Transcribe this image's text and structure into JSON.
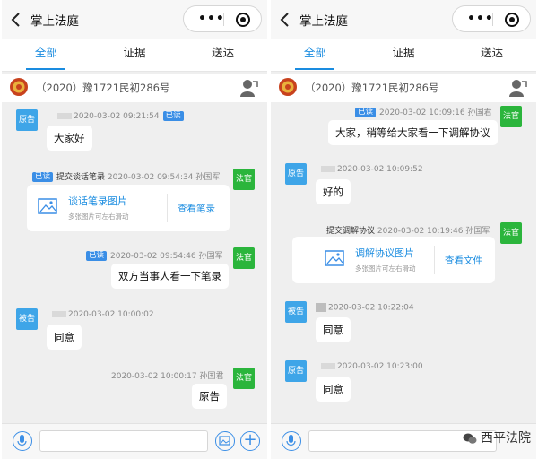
{
  "app": {
    "title": "掌上法庭"
  },
  "tabs": [
    {
      "label": "全部"
    },
    {
      "label": "证据"
    },
    {
      "label": "送达"
    }
  ],
  "case": {
    "number": "（2020）豫1721民初286号"
  },
  "colors": {
    "accent": "#1a8ce0",
    "plaintiff": "#3ea5e8",
    "judge": "#2bb53c",
    "read_badge": "#3a8ee6"
  },
  "left_panel": {
    "messages": [
      {
        "role": "原告",
        "time": "2020-03-02 09:21:54",
        "status": "已读",
        "text": "大家好"
      },
      {
        "role": "法官",
        "action": "提交谈话笔录",
        "status": "已读",
        "time": "2020-03-02 09:54:34",
        "name": "孙国军",
        "card": {
          "title": "谈话笔录图片",
          "subtitle": "多张图片可左右滑动",
          "action": "查看笔录"
        }
      },
      {
        "role": "法官",
        "status": "已读",
        "time": "2020-03-02 09:54:46",
        "name": "孙国军",
        "text": "双方当事人看一下笔录"
      },
      {
        "role": "被告",
        "time": "2020-03-02 10:00:02",
        "text": "同意"
      },
      {
        "role": "法官",
        "time": "2020-03-02 10:00:17",
        "name": "孙国君",
        "text": "原告"
      }
    ]
  },
  "right_panel": {
    "messages": [
      {
        "role": "法官",
        "status": "已读",
        "time": "2020-03-02 10:09:16",
        "name": "孙国君",
        "text": "大家，稍等给大家看一下调解协议"
      },
      {
        "role": "原告",
        "time": "2020-03-02 10:09:52",
        "text": "好的"
      },
      {
        "role": "法官",
        "action": "提交调解协议",
        "time": "2020-03-02 10:19:46",
        "name": "孙国军",
        "card": {
          "title": "调解协议图片",
          "subtitle": "多张图片可左右滑动",
          "action": "查看文件"
        }
      },
      {
        "role": "被告",
        "time": "2020-03-02 10:22:04",
        "text": "同意"
      },
      {
        "role": "原告",
        "time": "2020-03-02 10:23:00",
        "text": "同意"
      }
    ]
  },
  "watermark": {
    "text": "西平法院"
  }
}
